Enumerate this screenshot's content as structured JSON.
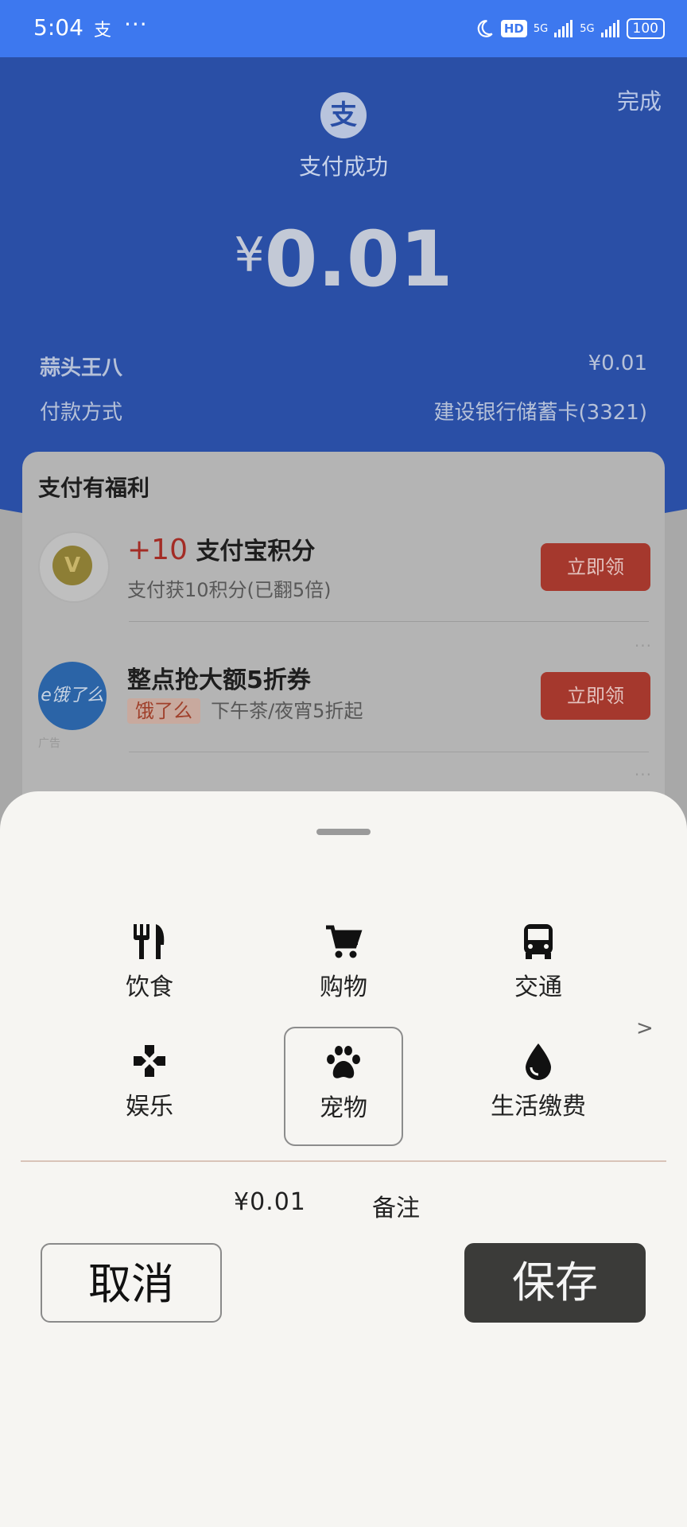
{
  "status_bar": {
    "time": "5:04",
    "app_icon": "支",
    "more": "···",
    "hd": "HD",
    "signal1": "5G",
    "signal2": "5G",
    "battery": "100"
  },
  "header": {
    "done": "完成",
    "logo": "支",
    "title": "支付成功",
    "currency": "¥",
    "amount": "0.01",
    "merchant_label": "蒜头王八",
    "merchant_value": "¥0.01",
    "method_label": "付款方式",
    "method_value": "建设银行储蓄卡(3321)"
  },
  "rewards": {
    "title": "支付有福利",
    "items": [
      {
        "icon": "V",
        "points": "+10",
        "title": "支付宝积分",
        "subtitle": "支付获10积分(已翻5倍)",
        "button": "立即领"
      },
      {
        "icon": "e饿了么",
        "title": "整点抢大额5折券",
        "tag": "饿了么",
        "subtitle": "下午茶/夜宵5折起",
        "button": "立即领",
        "ad_label": "广告"
      }
    ],
    "more": "···"
  },
  "sheet": {
    "categories": [
      {
        "label": "饮食",
        "icon": "fork-knife-icon"
      },
      {
        "label": "购物",
        "icon": "cart-icon"
      },
      {
        "label": "交通",
        "icon": "bus-icon"
      },
      {
        "label": "娱乐",
        "icon": "gamepad-icon"
      },
      {
        "label": "宠物",
        "icon": "paw-icon"
      },
      {
        "label": "生活缴费",
        "icon": "water-drop-icon"
      }
    ],
    "selected": "宠物",
    "next": ">",
    "amount": "¥0.01",
    "memo": "备注",
    "cancel": "取消",
    "save": "保存"
  }
}
